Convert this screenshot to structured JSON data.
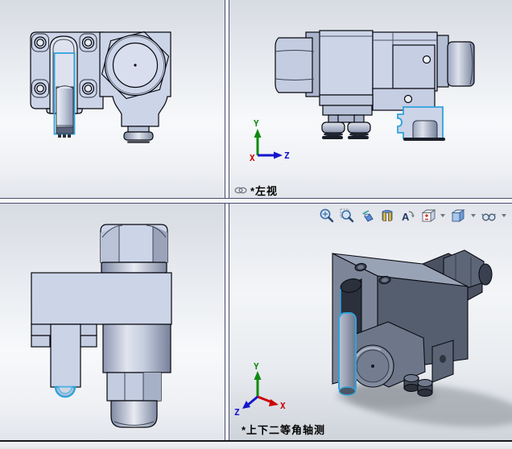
{
  "viewports": {
    "top_left": {
      "view_name": "front-view",
      "label": ""
    },
    "top_right": {
      "view_name": "left-view",
      "label": "*左视"
    },
    "bottom_left": {
      "view_name": "top-view",
      "label": ""
    },
    "bottom_right": {
      "view_name": "dimetric-view",
      "label": "*上下二等角轴测"
    }
  },
  "triads": {
    "x_label": "X",
    "y_label": "Y",
    "z_label": "Z"
  },
  "axis_colors": {
    "x": "#cc0000",
    "y": "#0d8a0d",
    "z": "#1515cc"
  },
  "colors": {
    "part_fill": "#ccd4e8",
    "part_outline": "#05070d",
    "selection_highlight": "#2fa3dc",
    "viewport_background_top": "#d7dbe2",
    "viewport_background_bottom": "#cfd4db",
    "splitter_edge": "#4c4c72"
  },
  "toolbar": {
    "icons": [
      {
        "name": "zoom-to-fit",
        "dropdown": false
      },
      {
        "name": "zoom-to-area",
        "dropdown": false
      },
      {
        "name": "previous-view",
        "dropdown": false
      },
      {
        "name": "section-view",
        "dropdown": false
      },
      {
        "name": "dynamic-annotation-views",
        "dropdown": false
      },
      {
        "name": "view-orientation",
        "dropdown": true
      },
      {
        "name": "display-style",
        "dropdown": true
      },
      {
        "name": "hide-show-items",
        "dropdown": true
      }
    ]
  }
}
